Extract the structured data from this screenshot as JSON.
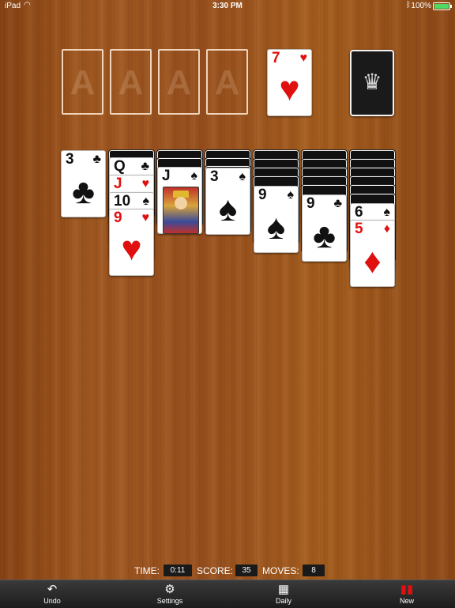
{
  "status_bar": {
    "device": "iPad",
    "time": "3:30 PM",
    "battery": "100%"
  },
  "foundations": {
    "placeholder_label": "A"
  },
  "waste": {
    "rank": "7",
    "suit": "♥"
  },
  "tableau": [
    {
      "column": 1,
      "face_down": 0,
      "face_up": [
        {
          "rank": "3",
          "suit": "♣"
        }
      ]
    },
    {
      "column": 2,
      "face_down": 1,
      "face_up": [
        {
          "rank": "Q",
          "suit": "♣"
        },
        {
          "rank": "J",
          "suit": "♥"
        },
        {
          "rank": "10",
          "suit": "♠"
        },
        {
          "rank": "9",
          "suit": "♥"
        }
      ]
    },
    {
      "column": 3,
      "face_down": 2,
      "face_up": [
        {
          "rank": "J",
          "suit": "♠"
        }
      ]
    },
    {
      "column": 4,
      "face_down": 3,
      "face_up": [
        {
          "rank": "3",
          "suit": "♠"
        }
      ]
    },
    {
      "column": 5,
      "face_down": 4,
      "face_up": [
        {
          "rank": "9",
          "suit": "♠"
        }
      ]
    },
    {
      "column": 6,
      "face_down": 5,
      "face_up": [
        {
          "rank": "9",
          "suit": "♣"
        }
      ]
    },
    {
      "column": 7,
      "face_down": 6,
      "face_up": [
        {
          "rank": "6",
          "suit": "♠"
        },
        {
          "rank": "5",
          "suit": "♦"
        }
      ]
    }
  ],
  "stats": {
    "time_label": "TIME:",
    "time_value": "0:11",
    "score_label": "SCORE:",
    "score_value": "35",
    "moves_label": "MOVES:",
    "moves_value": "8"
  },
  "toolbar": {
    "undo": "Undo",
    "settings": "Settings",
    "daily": "Daily",
    "new": "New"
  },
  "colors": {
    "red_suit": "#e01010",
    "black_suit": "#111111",
    "table_wood": "#9a5220"
  }
}
